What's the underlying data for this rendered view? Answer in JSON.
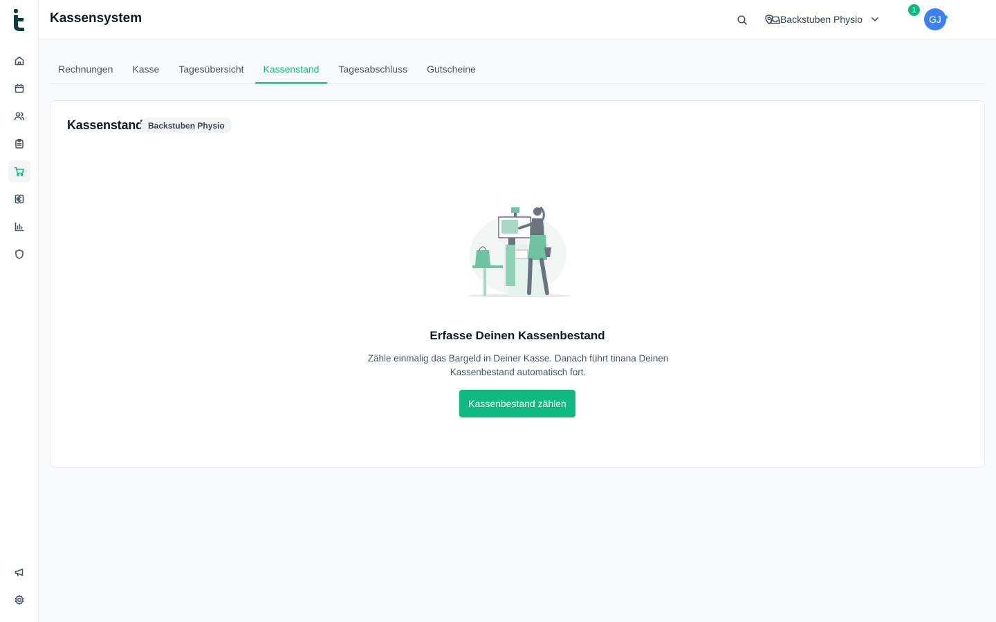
{
  "app": {
    "title": "Kassensystem"
  },
  "sidebar": {
    "logo": "tinana-logo",
    "items": [
      {
        "icon": "home-icon"
      },
      {
        "icon": "calendar-icon"
      },
      {
        "icon": "users-icon"
      },
      {
        "icon": "clipboard-icon"
      },
      {
        "icon": "shopping-cart-icon",
        "active": true
      },
      {
        "icon": "euro-icon"
      },
      {
        "icon": "bar-chart-icon"
      },
      {
        "icon": "shield-icon"
      }
    ],
    "bottom_items": [
      {
        "icon": "megaphone-icon"
      },
      {
        "icon": "gear-icon"
      }
    ]
  },
  "header": {
    "location_label": "Backstuben Physio",
    "notification_count": "1",
    "avatar_initials": "GJ"
  },
  "tabs": [
    {
      "label": "Rechnungen"
    },
    {
      "label": "Kasse"
    },
    {
      "label": "Tagesübersicht"
    },
    {
      "label": "Kassenstand",
      "active": true
    },
    {
      "label": "Tagesabschluss"
    },
    {
      "label": "Gutscheine"
    }
  ],
  "card": {
    "title": "Kassenstand",
    "chip": "Backstuben Physio",
    "empty_title": "Erfasse Deinen Kassenbestand",
    "empty_description": "Zähle einmalig das Bargeld in Deiner Kasse. Danach führt tinana Deinen Kassenbestand automatisch fort.",
    "cta_label": "Kassenbestand zählen"
  },
  "colors": {
    "accent": "#10b981",
    "avatar": "#3b82f6",
    "logo": "#0f3d3a"
  }
}
